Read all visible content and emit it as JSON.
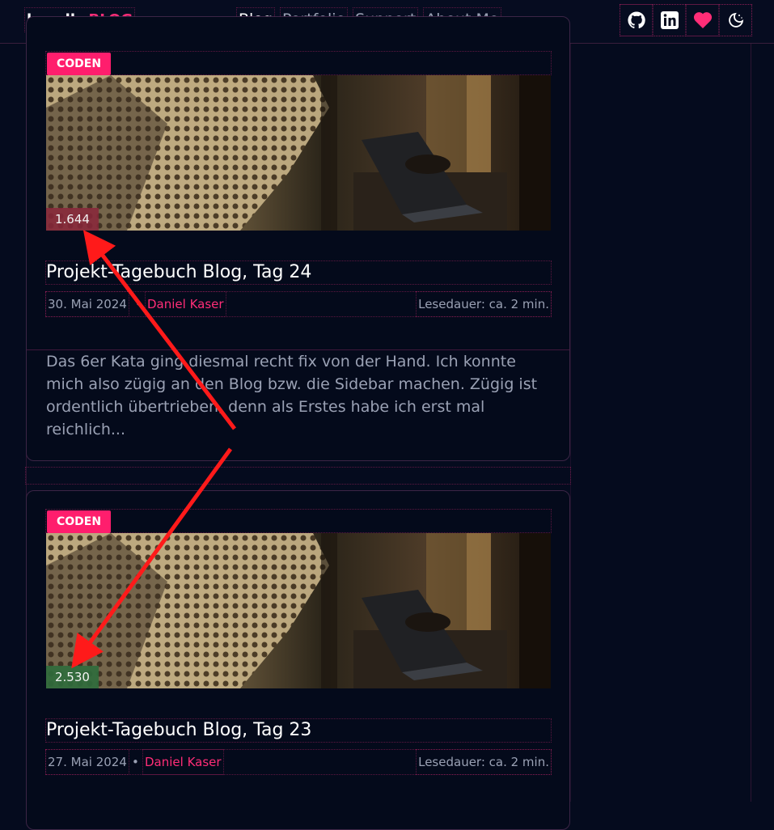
{
  "header": {
    "logo_part1": "kasulks",
    "logo_part2": "BLOG",
    "nav": [
      "Blog",
      "Portfolio",
      "Support",
      "About Me"
    ],
    "icons": [
      "github-icon",
      "linkedin-icon",
      "heart-icon",
      "theme-toggle-icon"
    ],
    "accent": "#ff2d77"
  },
  "posts": [
    {
      "category": "CODEN",
      "views": "1.644",
      "views_color": "#8a2639",
      "title": "Projekt-Tagebuch Blog, Tag 24",
      "date": "30. Mai 2024",
      "separator": "•",
      "author": "Daniel Kaser",
      "reading_time": "Lesedauer: ca. 2 min.",
      "excerpt": "Das 6er Kata ging diesmal recht fix von der Hand. Ich konnte mich also zügig an den Blog bzw. die Sidebar machen. Zügig ist ordentlich übertrieben, denn als Erstes habe ich erst mal reichlich..."
    },
    {
      "category": "CODEN",
      "views": "2.530",
      "views_color": "#2f6b3c",
      "title": "Projekt-Tagebuch Blog, Tag 23",
      "date": "27. Mai 2024",
      "separator": "•",
      "author": "Daniel Kaser",
      "reading_time": "Lesedauer: ca. 2 min."
    }
  ]
}
